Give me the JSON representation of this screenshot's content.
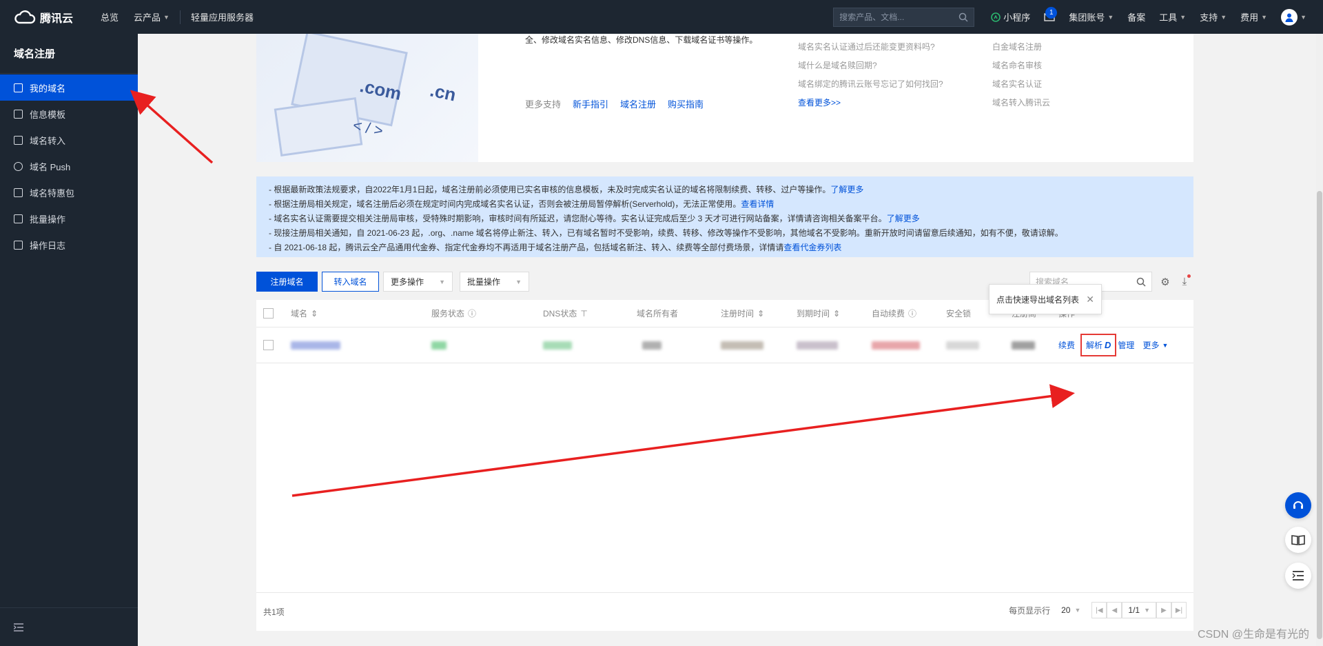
{
  "topbar": {
    "brand": "腾讯云",
    "nav": [
      "总览",
      "云产品",
      "轻量应用服务器"
    ],
    "search_placeholder": "搜索产品、文档...",
    "miniprogram": "小程序",
    "mail_count": "1",
    "right_items": [
      "集团账号",
      "备案",
      "工具",
      "支持",
      "费用"
    ]
  },
  "sidebar": {
    "title": "域名注册",
    "items": [
      {
        "label": "我的域名",
        "active": true
      },
      {
        "label": "信息模板"
      },
      {
        "label": "域名转入"
      },
      {
        "label": "域名 Push"
      },
      {
        "label": "域名特惠包"
      },
      {
        "label": "批量操作"
      },
      {
        "label": "操作日志"
      }
    ]
  },
  "hero": {
    "art_com": ".com",
    "art_cn": ".cn",
    "art_code": "< / >",
    "desc": "全、修改域名实名信息、修改DNS信息、下载域名证书等操作。",
    "links_label": "更多支持",
    "links": [
      "新手指引",
      "域名注册",
      "购买指南"
    ],
    "faq": [
      "域名实名认证通过后还能变更资料吗?",
      "域什么是域名赎回期?",
      "域名绑定的腾讯云账号忘记了如何找回?"
    ],
    "faq_more": "查看更多>>",
    "faq2": [
      "白金域名注册",
      "域名命名审核",
      "域名实名认证",
      "域名转入腾讯云"
    ]
  },
  "notice": [
    {
      "text": "- 根据最新政策法规要求，自2022年1月1日起，域名注册前必须使用已实名审核的信息模板，未及时完成实名认证的域名将限制续费、转移、过户等操作。",
      "link": "了解更多"
    },
    {
      "text": "- 根据注册局相关规定，域名注册后必须在规定时间内完成域名实名认证，否则会被注册局暂停解析(Serverhold)，无法正常使用。",
      "link": "查看详情"
    },
    {
      "text": "- 域名实名认证需要提交相关注册局审核，受特殊时期影响，审核时间有所延迟，请您耐心等待。实名认证完成后至少 3 天才可进行网站备案，详情请咨询相关备案平台。",
      "link": "了解更多"
    },
    {
      "text": "- 现接注册局相关通知，自 2021-06-23 起，.org、.name 域名将停止新注、转入，已有域名暂时不受影响，续费、转移、修改等操作不受影响，其他域名不受影响。重新开放时间请留意后续通知，如有不便，敬请谅解。",
      "link": ""
    },
    {
      "text": "- 自 2021-06-18 起，腾讯云全产品通用代金券、指定代金券均不再适用于域名注册产品，包括域名新注、转入、续费等全部付费场景，详情请",
      "link": "查看代金券列表"
    }
  ],
  "toolbar": {
    "register": "注册域名",
    "transfer": "转入域名",
    "more_ops": "更多操作",
    "batch_ops": "批量操作",
    "search_placeholder": "搜索域名"
  },
  "tooltip": "点击快速导出域名列表",
  "table": {
    "columns": [
      "域名",
      "服务状态",
      "DNS状态",
      "域名所有者",
      "注册时间",
      "到期时间",
      "自动续费",
      "安全锁",
      "注册商",
      "操作"
    ],
    "row_actions": {
      "renew": "续费",
      "resolve": "解析",
      "manage": "管理",
      "more": "更多"
    },
    "total": "共1项",
    "page_size_label": "每页显示行",
    "page_size": "20",
    "page": "1/1"
  },
  "watermark": "CSDN @生命是有光的",
  "colors": {
    "primary": "#0052d9",
    "highlight": "#e53935",
    "nav_bg": "#1d2631"
  }
}
